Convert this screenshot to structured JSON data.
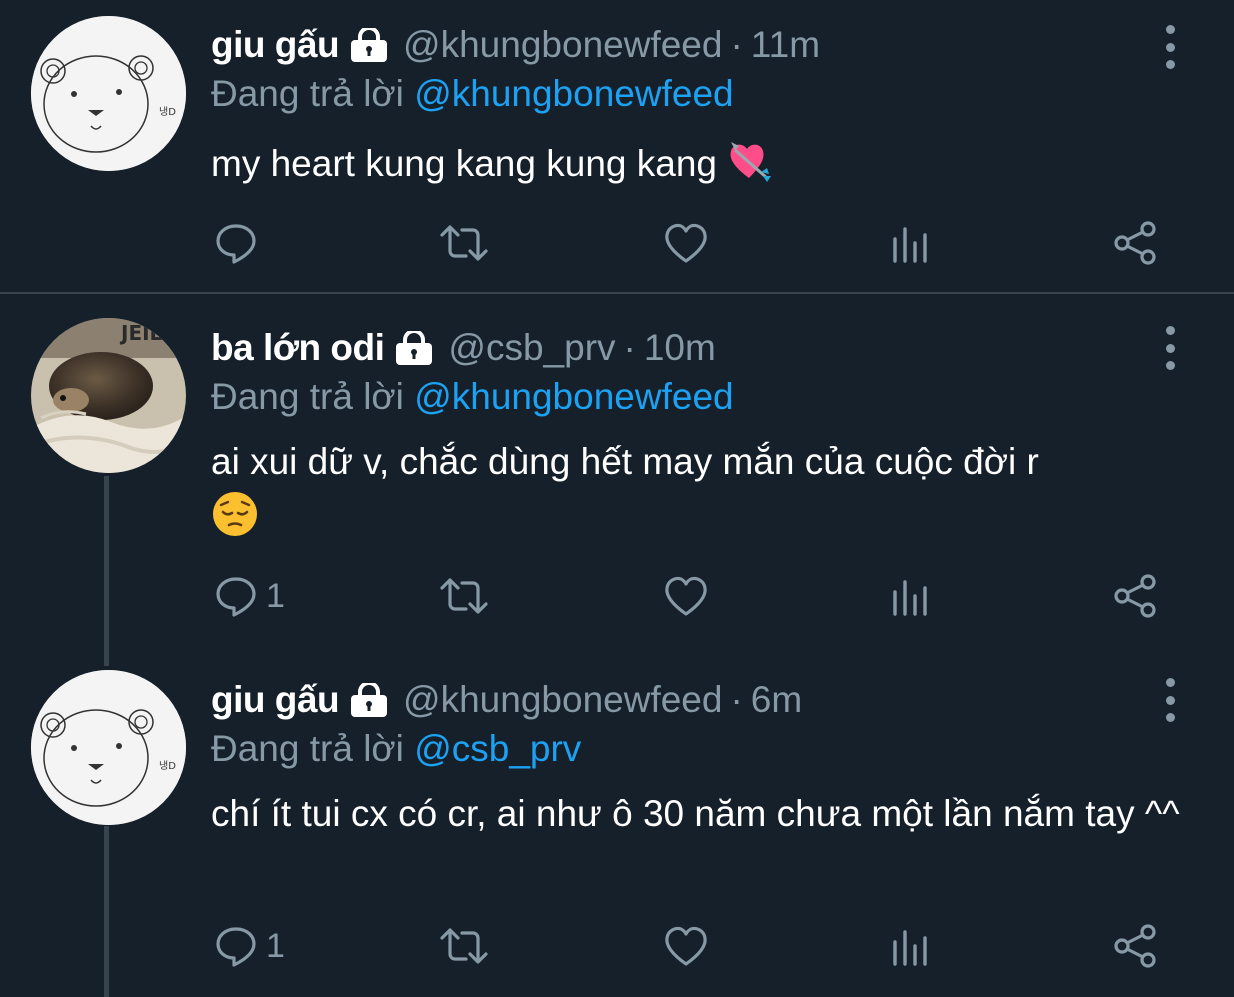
{
  "tweets": [
    {
      "name": "giu gấu",
      "handle": "@khungbonewfeed",
      "dot": "·",
      "time": "11m",
      "reply_prefix": "Đang trả lời ",
      "reply_to": "@khungbonewfeed",
      "text": "my heart kung kang kung kang",
      "emoji": "heart-with-arrow",
      "reply_count": "",
      "avatar": "bear-drawing"
    },
    {
      "name": "ba lớn odi",
      "handle": "@csb_prv",
      "dot": "·",
      "time": "10m",
      "reply_prefix": "Đang trả lời ",
      "reply_to": "@khungbonewfeed",
      "text": "ai xui dữ v, chắc dùng hết may mắn của cuộc đời r",
      "emoji": "pensive-face",
      "reply_count": "1",
      "avatar": "hedgehog-photo"
    },
    {
      "name": "giu gấu",
      "handle": "@khungbonewfeed",
      "dot": "·",
      "time": "6m",
      "reply_prefix": "Đang trả lời ",
      "reply_to": "@csb_prv",
      "text": "chí ít tui cx có cr, ai như ô 30 năm chưa một lần nắm tay ^^",
      "emoji": "",
      "reply_count": "1",
      "avatar": "bear-drawing"
    }
  ],
  "colors": {
    "background": "#15202b",
    "secondary_text": "#8899a6",
    "link": "#1da1f2",
    "divider": "#38444d"
  }
}
